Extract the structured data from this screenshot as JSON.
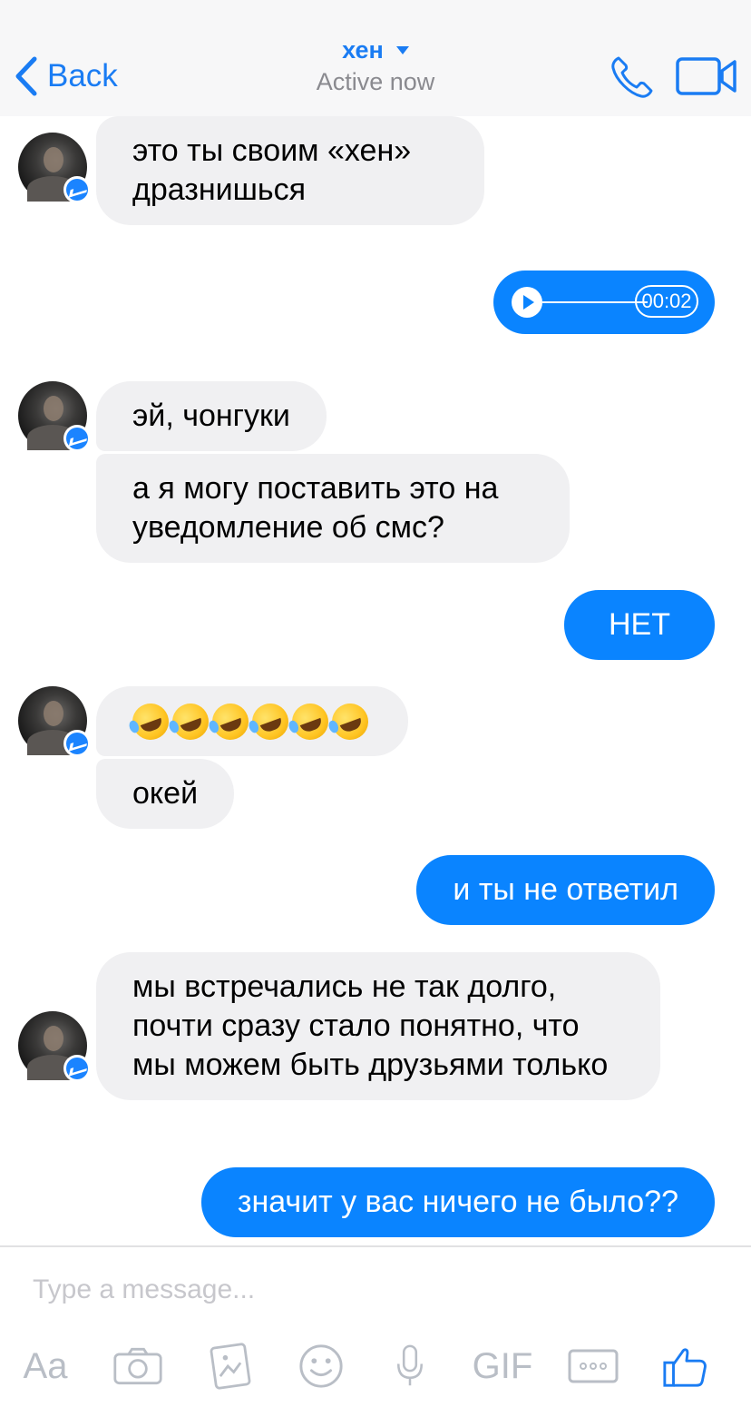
{
  "header": {
    "back_label": "Back",
    "contact_name": "хен",
    "status": "Active now"
  },
  "messages": [
    {
      "dir": "in",
      "text": "это ты своим «хен» дразнишься"
    },
    {
      "dir": "out",
      "type": "audio",
      "duration": "00:02"
    },
    {
      "dir": "in",
      "text": "эй, чонгуки"
    },
    {
      "dir": "in",
      "text": "а я могу поставить это на уведомление об смс?"
    },
    {
      "dir": "out",
      "text": "НЕТ"
    },
    {
      "dir": "in",
      "type": "emoji",
      "emoji_name": "rolling-on-the-floor-laughing",
      "count": 6
    },
    {
      "dir": "in",
      "text": "окей"
    },
    {
      "dir": "out",
      "text": "и ты не ответил"
    },
    {
      "dir": "in",
      "text": "мы встречались не так долго, почти сразу стало понятно, что мы можем быть друзьями только"
    },
    {
      "dir": "out",
      "text": "значит у вас ничего не было??"
    }
  ],
  "composer": {
    "placeholder": "Type a message..."
  },
  "toolbar": {
    "font_label": "Aa",
    "gif_label": "GIF",
    "icons": [
      "camera-icon",
      "photo-icon",
      "emoji-icon",
      "microphone-icon",
      "more-icon",
      "like-icon"
    ]
  },
  "colors": {
    "accent": "#0a84ff",
    "incoming_bubble": "#f0f0f2",
    "toolbar_icon": "#b9bec6"
  }
}
